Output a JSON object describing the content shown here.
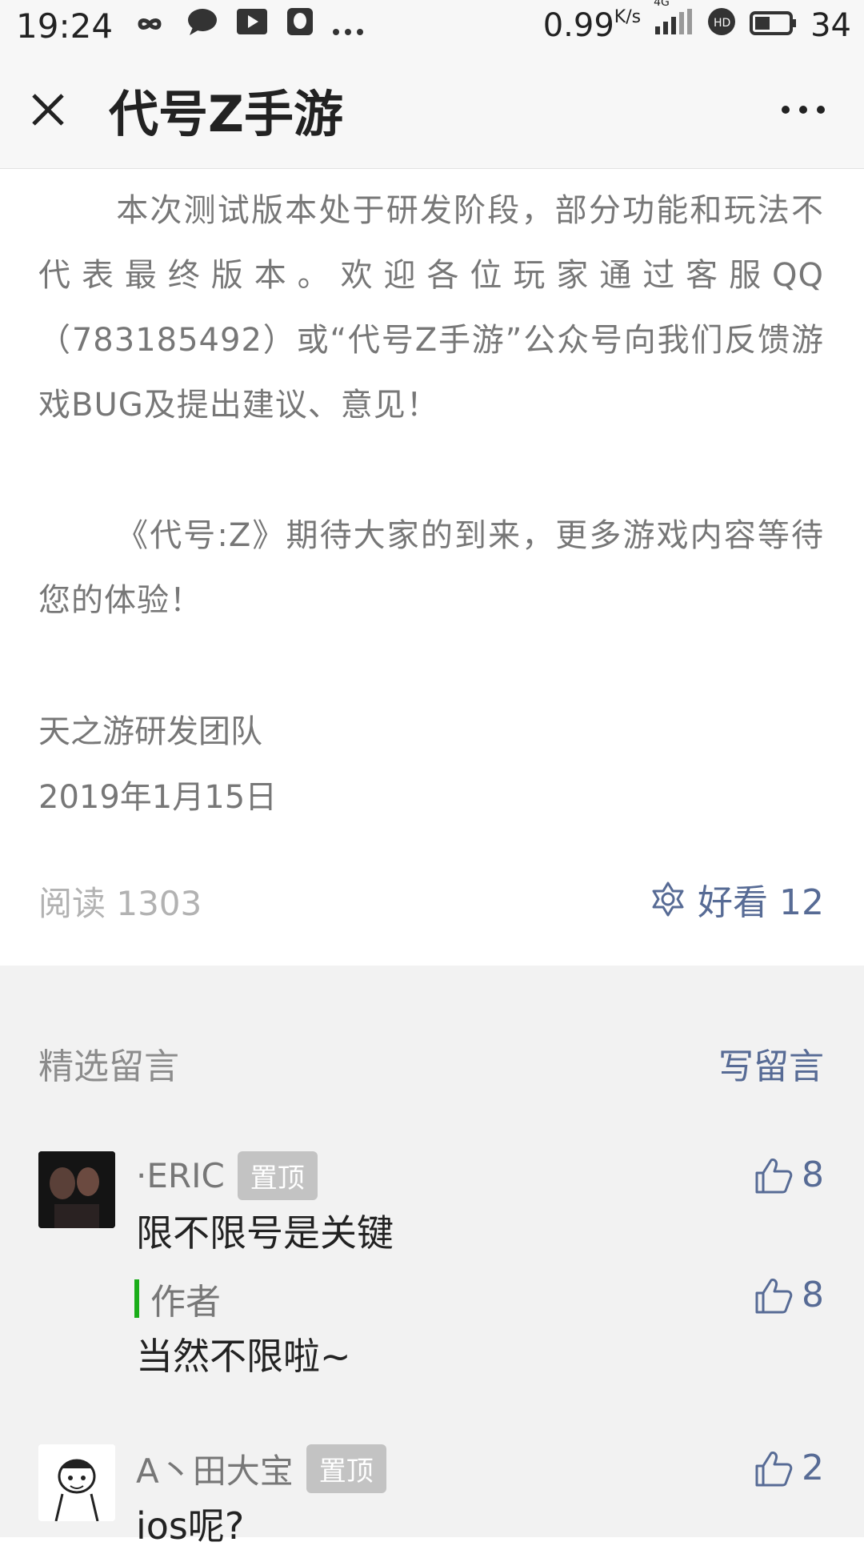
{
  "status_bar": {
    "time": "19:24",
    "speed": "0.99",
    "speed_unit": "K/s",
    "network": "4G",
    "battery": "34",
    "icons": [
      "infinity-icon",
      "chat-bubble-icon",
      "video-play-icon",
      "qq-penguin-icon",
      "more-dots-icon",
      "signal-icon",
      "hd-call-icon",
      "battery-icon"
    ]
  },
  "header": {
    "title": "代号Z手游",
    "close_icon": "close-icon",
    "more_icon": "more-horizontal-icon"
  },
  "article": {
    "paragraph1": "本次测试版本处于研发阶段，部分功能和玩法不代表最终版本。欢迎各位玩家通过客服QQ（783185492）或“代号Z手游”公众号向我们反馈游戏BUG及提出建议、意见！",
    "paragraph2": "《代号:Z》期待大家的到来，更多游戏内容等待您的体验！",
    "signature_team": "天之游研发团队",
    "signature_date": "2019年1月15日",
    "reads_label": "阅读 1303",
    "haokan_label": "好看 12"
  },
  "comments": {
    "section_title": "精选留言",
    "write_label": "写留言",
    "items": [
      {
        "nickname": "·ERIC",
        "pin_label": "置顶",
        "text": "限不限号是关键",
        "likes": "8",
        "reply": {
          "author_label": "作者",
          "text": "当然不限啦~",
          "likes": "8"
        }
      },
      {
        "nickname": "A丶田大宝",
        "pin_label": "置顶",
        "text": "ios呢?",
        "likes": "2"
      }
    ]
  },
  "colors": {
    "link_blue": "#576b95",
    "author_green": "#1aad19",
    "body_gray": "#777777",
    "comment_bg": "#f2f2f2"
  }
}
